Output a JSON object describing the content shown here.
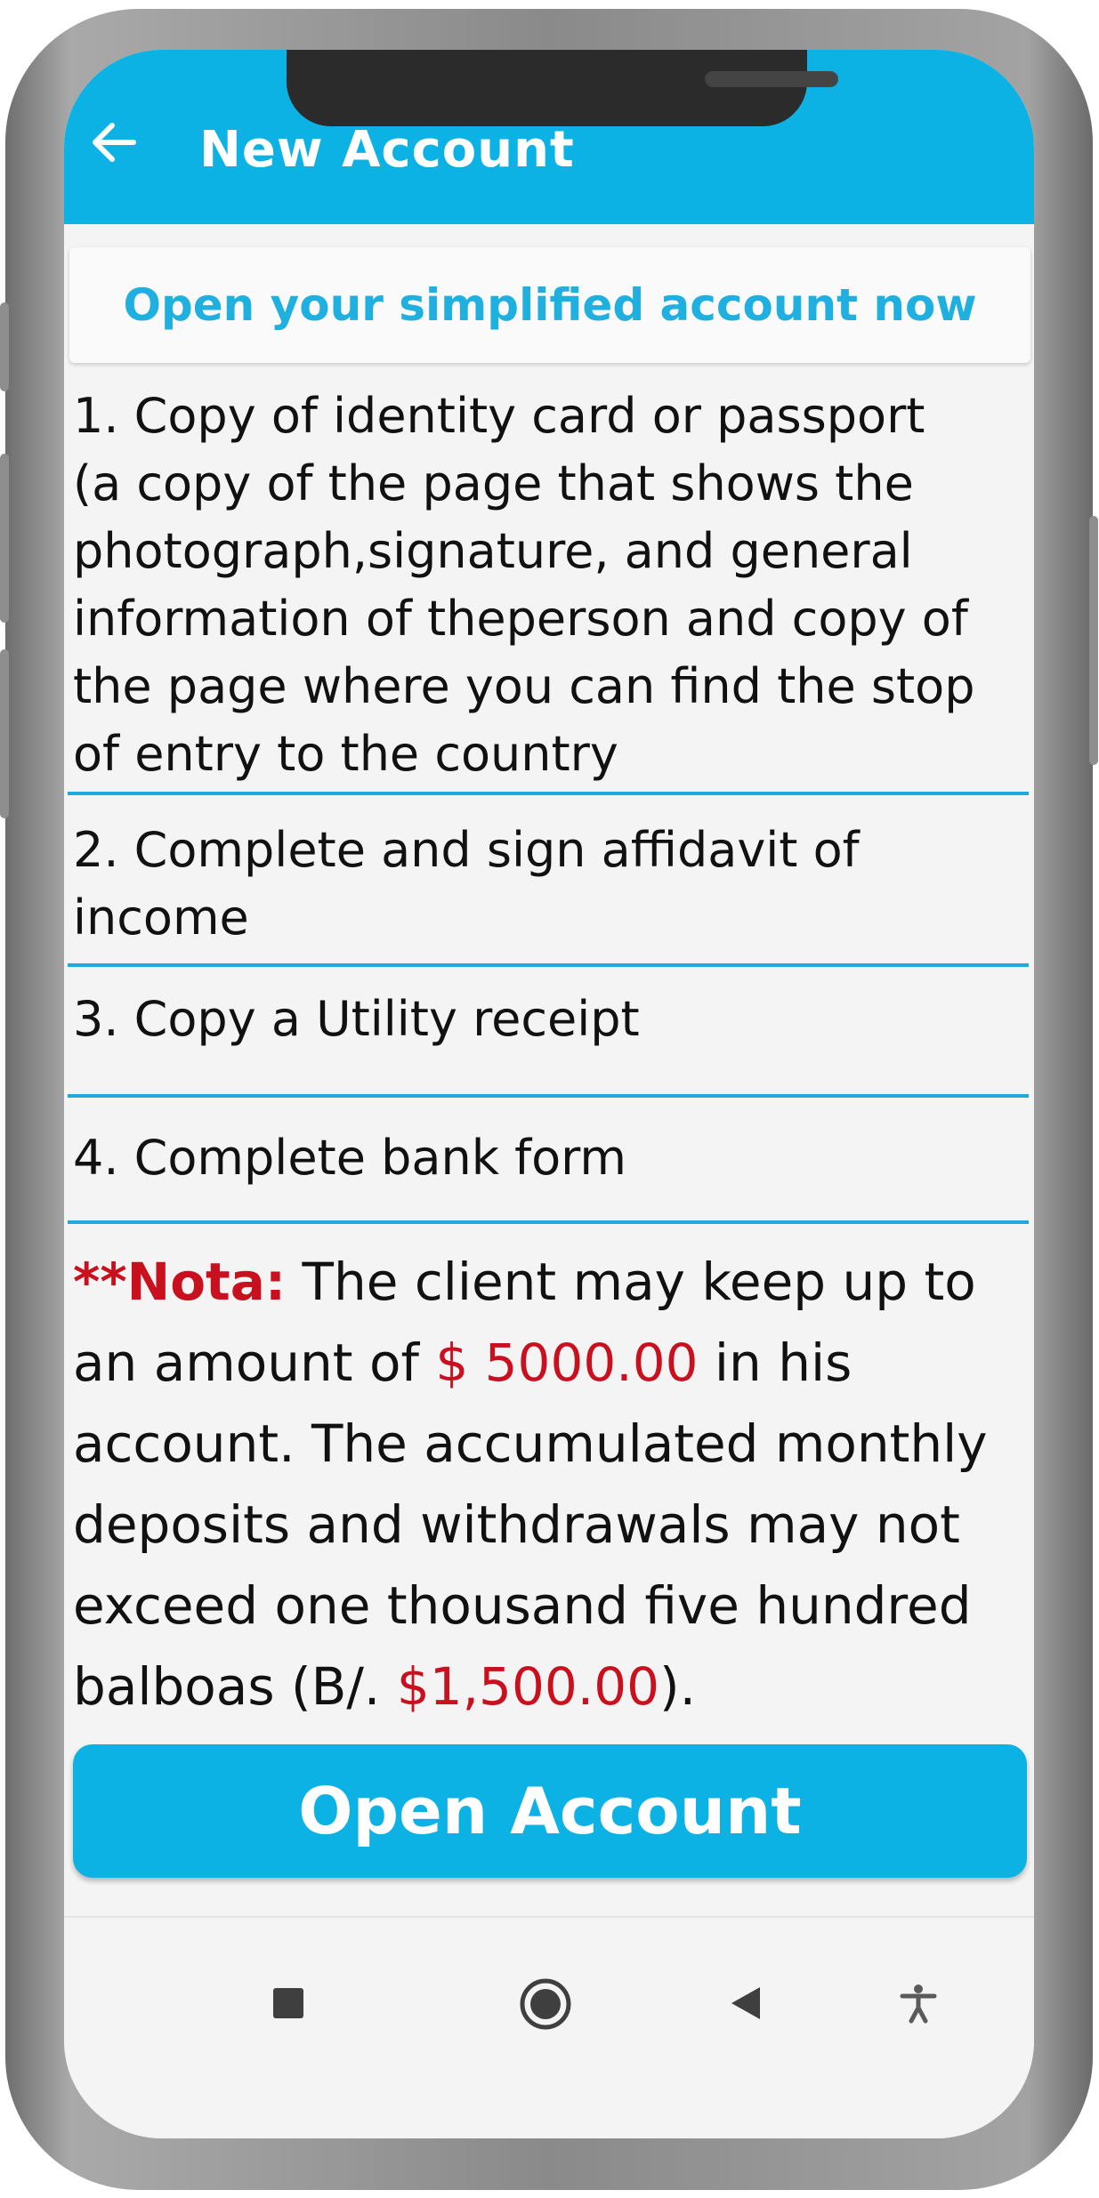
{
  "header": {
    "title": "New Account",
    "color": "#0db2e4"
  },
  "subheader": {
    "text": "Open your simplified account now"
  },
  "requirements": [
    {
      "lines": [
        "1. Copy of identity card or passport",
        "(a copy of the page that shows the",
        "photograph,signature, and general",
        "information of theperson and copy of",
        " the page where you can find the stop",
        " of entry to the country"
      ]
    },
    {
      "lines": [
        "2. Complete and sign affidavit of",
        " income"
      ]
    },
    {
      "lines": [
        "3. Copy a Utility receipt"
      ]
    },
    {
      "lines": [
        "4. Complete bank form"
      ]
    }
  ],
  "note": {
    "label": "**Nota:",
    "line1_rest": " The client may keep up to",
    "line2_pre": "an amount of ",
    "amount1": "$ 5000.00",
    "line2_post": " in his",
    "line3": "account. The accumulated monthly",
    "line4": "deposits and withdrawals may not",
    "line5": "exceed one thousand five hundred",
    "line6_pre": "balboas (B/. ",
    "amount2": "$1,500.00",
    "line6_post": ")."
  },
  "open_button": {
    "label": "Open Account"
  },
  "icons": {
    "back": "arrow-left-icon",
    "recents": "square-icon",
    "home": "circle-icon",
    "back_nav": "triangle-back-icon",
    "accessibility": "accessibility-icon"
  },
  "colors": {
    "accent": "#0db2e4",
    "note_red": "#c8101f",
    "divider": "#1fa9dd"
  }
}
